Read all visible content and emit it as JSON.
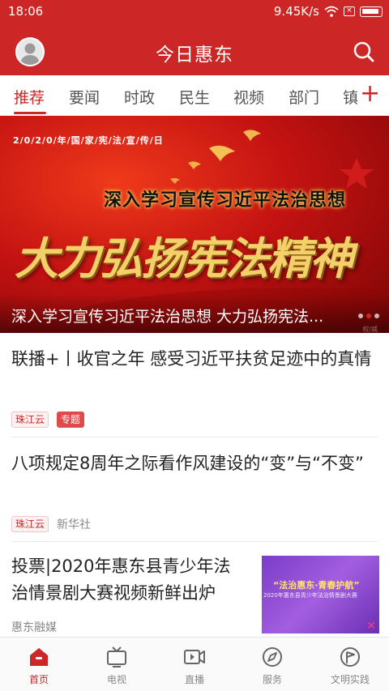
{
  "status_bar": {
    "time": "18:06",
    "signal_dots": "...",
    "network_speed": "9.45K/s"
  },
  "header": {
    "title": "今日惠东",
    "avatar_icon": "user-avatar-icon",
    "search_icon": "search-icon",
    "background_color": "#cc2626"
  },
  "tabs": {
    "items": [
      {
        "label": "推荐",
        "active": true
      },
      {
        "label": "要闻",
        "active": false
      },
      {
        "label": "时政",
        "active": false
      },
      {
        "label": "民生",
        "active": false
      },
      {
        "label": "视频",
        "active": false
      },
      {
        "label": "部门",
        "active": false
      },
      {
        "label": "镇",
        "active": false
      }
    ],
    "add_label": "+"
  },
  "banner": {
    "date_line": "2/0/2/0/年/国/家/宪/法/宣/传/日",
    "subtitle": "深入学习宣传习近平法治思想",
    "slogan": "大力弘扬宪法精神",
    "caption": "深入学习宣传习近平法治思想 大力弘扬宪法...",
    "watermark": "权/威",
    "slide_count": 3,
    "active_slide": 1
  },
  "articles": [
    {
      "title": "联播+丨收官之年 感受习近平扶贫足迹中的真情",
      "tag": "珠江云",
      "badge": "专题"
    },
    {
      "title": "八项规定8周年之际看作风建设的“变”与“不变”",
      "tag": "珠江云",
      "source": "新华社"
    },
    {
      "title": "投票|2020年惠东县青少年法治情景剧大赛视频新鲜出炉",
      "source": "惠东融媒",
      "thumb_title": "“法治惠东·青春护航”",
      "thumb_sub": "2020年惠东县青少年法治情景剧大赛"
    }
  ],
  "bottom_nav": {
    "items": [
      {
        "label": "首页",
        "icon": "home-icon",
        "active": true
      },
      {
        "label": "电视",
        "icon": "tv-icon",
        "active": false
      },
      {
        "label": "直播",
        "icon": "live-video-icon",
        "active": false
      },
      {
        "label": "服务",
        "icon": "compass-icon",
        "active": false
      },
      {
        "label": "文明实践",
        "icon": "flag-icon",
        "active": false
      }
    ]
  },
  "colors": {
    "accent": "#cc2626",
    "text_primary": "#222222",
    "text_secondary": "#888888"
  }
}
